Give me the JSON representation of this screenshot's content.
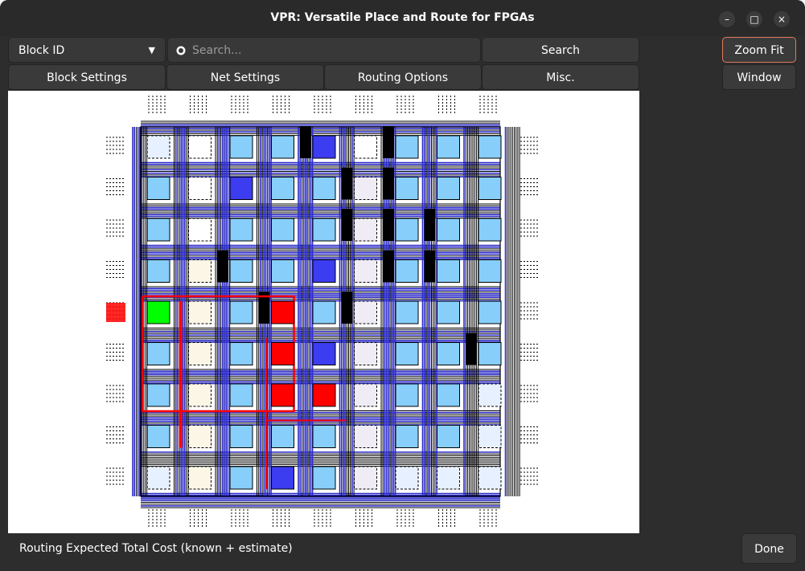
{
  "window": {
    "title": "VPR: Versatile Place and Route for FPGAs",
    "controls": [
      "–",
      "□",
      "×"
    ]
  },
  "toolbar": {
    "search_type": "Block ID",
    "search_placeholder": "Search...",
    "search_button": "Search",
    "zoom_fit": "Zoom Fit",
    "window_button": "Window",
    "tabs": [
      "Block Settings",
      "Net Settings",
      "Routing Options",
      "Misc."
    ]
  },
  "status": {
    "text": "Routing Expected Total Cost (known + estimate)",
    "done": "Done"
  },
  "colors": {
    "clb_light": "#87cefa",
    "clb_blue": "#3c3cf0",
    "critical": "#ff0000",
    "source": "#00ff00",
    "lavender": "#f0ecf6",
    "cream": "#fbf6e6",
    "pale": "#e6f0ff",
    "route_blue": "#2c2cc8"
  },
  "fpga": {
    "tiles": [
      [
        "pale",
        "white",
        "light",
        "light",
        "blue",
        "white",
        "light",
        "light",
        "light"
      ],
      [
        "light",
        "white",
        "blue",
        "light",
        "light",
        "lavender",
        "light",
        "light",
        "light"
      ],
      [
        "light",
        "white",
        "light",
        "light",
        "light",
        "lavender",
        "light",
        "light",
        "light"
      ],
      [
        "light",
        "cream",
        "light",
        "light",
        "blue",
        "lavender",
        "light",
        "light",
        "light"
      ],
      [
        "green",
        "cream",
        "light",
        "red",
        "light",
        "lavender",
        "light",
        "light",
        "light"
      ],
      [
        "light",
        "cream",
        "light",
        "red",
        "blue",
        "lavender",
        "light",
        "light",
        "light"
      ],
      [
        "light",
        "cream",
        "light",
        "red",
        "red",
        "lavender",
        "light",
        "light",
        "pale"
      ],
      [
        "light",
        "cream",
        "light",
        "light",
        "light",
        "lavender",
        "light",
        "light",
        "pale"
      ],
      [
        "pale",
        "cream",
        "light",
        "blue",
        "light",
        "lavender",
        "pale",
        "pale",
        "pale"
      ]
    ]
  }
}
